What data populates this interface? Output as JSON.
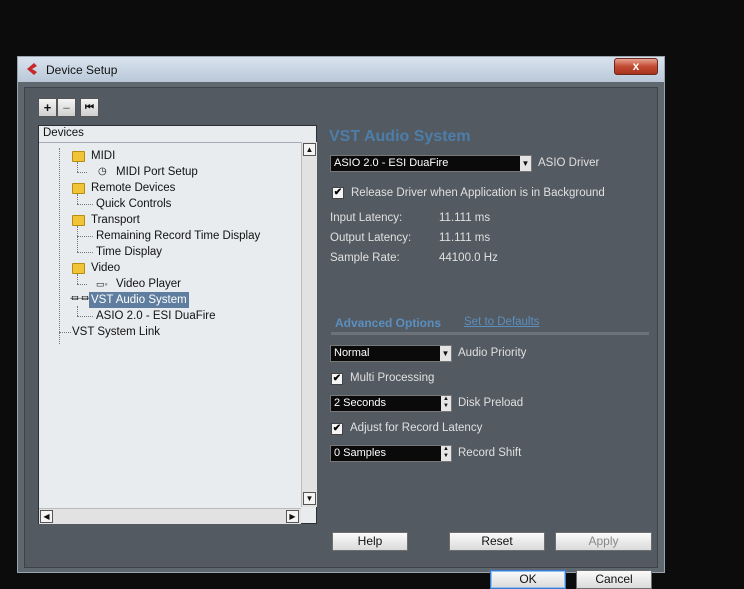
{
  "window": {
    "title": "Device Setup",
    "close_label": "x"
  },
  "toolbar": {
    "add_label": "+",
    "remove_label": "–",
    "reset_label": "⏮"
  },
  "tree": {
    "header": "Devices",
    "items": [
      {
        "label": "MIDI"
      },
      {
        "label": "MIDI Port Setup"
      },
      {
        "label": "Remote Devices"
      },
      {
        "label": "Quick Controls"
      },
      {
        "label": "Transport"
      },
      {
        "label": "Remaining Record Time Display"
      },
      {
        "label": "Time Display"
      },
      {
        "label": "Video"
      },
      {
        "label": "Video Player"
      },
      {
        "label": "VST Audio System"
      },
      {
        "label": "ASIO 2.0 - ESI DuaFire"
      },
      {
        "label": "VST System Link"
      }
    ]
  },
  "panel": {
    "title": "VST Audio System",
    "asio_driver": {
      "value": "ASIO 2.0 - ESI DuaFire",
      "label": "ASIO Driver"
    },
    "release_driver": {
      "checked": true,
      "label": "Release Driver when Application is in Background"
    },
    "input_latency": {
      "label": "Input Latency:",
      "value": "11.111 ms"
    },
    "output_latency": {
      "label": "Output Latency:",
      "value": "11.111 ms"
    },
    "sample_rate": {
      "label": "Sample Rate:",
      "value": "44100.0 Hz"
    },
    "advanced_label": "Advanced Options",
    "defaults_link": "Set to Defaults",
    "audio_priority": {
      "value": "Normal",
      "label": "Audio Priority"
    },
    "multi_processing": {
      "checked": true,
      "label": "Multi Processing"
    },
    "disk_preload": {
      "value": "2 Seconds",
      "label": "Disk Preload"
    },
    "adjust_latency": {
      "checked": true,
      "label": "Adjust for Record Latency"
    },
    "record_shift": {
      "value": "0 Samples",
      "label": "Record Shift"
    }
  },
  "buttons": {
    "help": "Help",
    "reset": "Reset",
    "apply": "Apply",
    "ok": "OK",
    "cancel": "Cancel"
  },
  "colors": {
    "accent": "#4d7ea9",
    "selection": "#5f7e9f",
    "panel_bg": "#535a61"
  }
}
